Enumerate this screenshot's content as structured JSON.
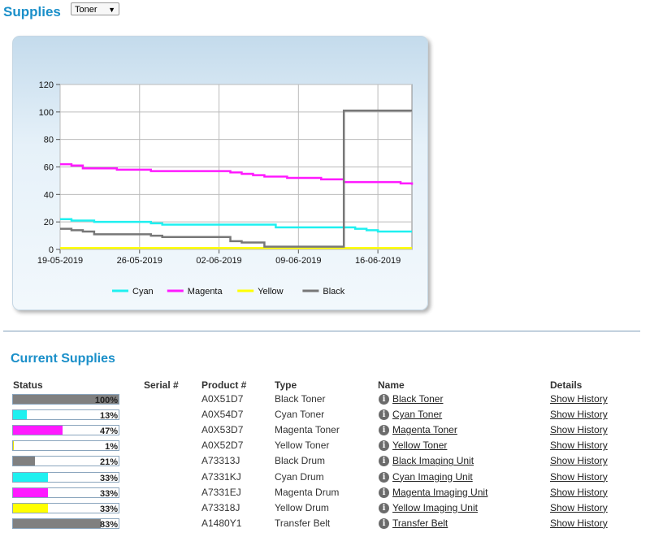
{
  "header": {
    "title": "Supplies",
    "filter_selected": "Toner"
  },
  "chart_data": {
    "type": "line",
    "x_dates": [
      "19-05-2019",
      "26-05-2019",
      "02-06-2019",
      "09-06-2019",
      "16-06-2019"
    ],
    "ylim": [
      0,
      120
    ],
    "y_ticks": [
      "0",
      "20",
      "40",
      "60",
      "80",
      "100",
      "120"
    ],
    "grid": true,
    "legend_position": "bottom",
    "series": [
      {
        "name": "Cyan",
        "color": "#1ff0f0",
        "x": [
          0,
          1,
          2,
          3,
          4,
          5,
          7,
          8,
          9,
          10,
          11,
          12,
          13,
          14,
          16,
          17,
          18,
          19,
          20,
          21,
          22,
          23,
          24,
          25,
          26,
          27,
          28,
          29,
          30,
          31
        ],
        "y": [
          22,
          21,
          21,
          20,
          20,
          20,
          20,
          19,
          18,
          18,
          18,
          18,
          18,
          18,
          18,
          18,
          18,
          16,
          16,
          16,
          16,
          16,
          16,
          16,
          15,
          14,
          13,
          13,
          13,
          13
        ]
      },
      {
        "name": "Magenta",
        "color": "#ff1aff",
        "x": [
          0,
          1,
          2,
          3,
          5,
          7,
          8,
          9,
          10,
          11,
          12,
          13,
          14,
          15,
          16,
          17,
          18,
          19,
          20,
          21,
          22,
          23,
          24,
          25,
          26,
          27,
          28,
          29,
          30,
          31
        ],
        "y": [
          62,
          61,
          59,
          59,
          58,
          58,
          57,
          57,
          57,
          57,
          57,
          57,
          57,
          56,
          55,
          54,
          53,
          53,
          52,
          52,
          52,
          51,
          51,
          49,
          49,
          49,
          49,
          49,
          48,
          47
        ]
      },
      {
        "name": "Yellow",
        "color": "#ffff00",
        "x": [
          0,
          31
        ],
        "y": [
          1,
          1
        ]
      },
      {
        "name": "Black",
        "color": "#777777",
        "x": [
          0,
          1,
          2,
          3,
          4,
          5,
          7,
          8,
          9,
          10,
          11,
          12,
          13,
          14,
          15,
          16,
          17,
          18,
          19,
          20,
          21,
          22,
          23,
          24,
          25,
          26,
          27,
          28,
          29,
          30,
          31
        ],
        "y": [
          15,
          14,
          13,
          11,
          11,
          11,
          11,
          10,
          9,
          9,
          9,
          9,
          9,
          9,
          6,
          5,
          5,
          2,
          2,
          2,
          2,
          2,
          2,
          2,
          101,
          101,
          101,
          101,
          101,
          101,
          101
        ]
      }
    ]
  },
  "current": {
    "title": "Current Supplies",
    "headers": {
      "status": "Status",
      "serial": "Serial #",
      "product": "Product #",
      "type": "Type",
      "name": "Name",
      "details": "Details"
    },
    "rows": [
      {
        "pct": "100%",
        "level": 1.0,
        "color": "#808080",
        "serial": "",
        "product": "A0X51D7",
        "type": "Black Toner",
        "name": "Black Toner",
        "details": "Show History"
      },
      {
        "pct": "13%",
        "level": 0.13,
        "color": "#1ff0f0",
        "serial": "",
        "product": "A0X54D7",
        "type": "Cyan Toner",
        "name": "Cyan Toner",
        "details": "Show History"
      },
      {
        "pct": "47%",
        "level": 0.47,
        "color": "#ff1aff",
        "serial": "",
        "product": "A0X53D7",
        "type": "Magenta Toner",
        "name": "Magenta Toner",
        "details": "Show History"
      },
      {
        "pct": "1%",
        "level": 0.01,
        "color": "#e6e600",
        "serial": "",
        "product": "A0X52D7",
        "type": "Yellow Toner",
        "name": "Yellow Toner",
        "details": "Show History"
      },
      {
        "pct": "21%",
        "level": 0.21,
        "color": "#808080",
        "serial": "",
        "product": "A73313J",
        "type": "Black Drum",
        "name": "Black Imaging Unit",
        "details": "Show History"
      },
      {
        "pct": "33%",
        "level": 0.33,
        "color": "#1ff0f0",
        "serial": "",
        "product": "A7331KJ",
        "type": "Cyan Drum",
        "name": "Cyan Imaging Unit",
        "details": "Show History"
      },
      {
        "pct": "33%",
        "level": 0.33,
        "color": "#ff1aff",
        "serial": "",
        "product": "A7331EJ",
        "type": "Magenta Drum",
        "name": "Magenta Imaging Unit",
        "details": "Show History"
      },
      {
        "pct": "33%",
        "level": 0.33,
        "color": "#ffff00",
        "serial": "",
        "product": "A73318J",
        "type": "Yellow Drum",
        "name": "Yellow Imaging Unit",
        "details": "Show History"
      },
      {
        "pct": "83%",
        "level": 0.83,
        "color": "#808080",
        "serial": "",
        "product": "A1480Y1",
        "type": "Transfer Belt",
        "name": "Transfer Belt",
        "details": "Show History"
      }
    ]
  }
}
